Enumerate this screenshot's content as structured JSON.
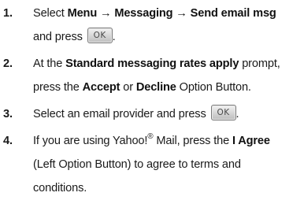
{
  "steps": [
    {
      "number": "1.",
      "line1_a": "Select ",
      "menu_path": "Menu → Messaging → Send email msg",
      "line2_a": "and press ",
      "ok_key": "OK",
      "line2_b": "."
    },
    {
      "number": "2.",
      "line1_a": "At the ",
      "prompt_name": "Standard messaging rates apply",
      "line1_b": " prompt,",
      "line2_a": "press the ",
      "accept": "Accept",
      "or": " or ",
      "decline": "Decline",
      "line2_b": " Option Button."
    },
    {
      "number": "3.",
      "line1_a": "Select an email provider and press ",
      "ok_key": "OK",
      "line1_b": "."
    },
    {
      "number": "4.",
      "line1_a": "If you are using Yahoo!",
      "registered": "®",
      "line1_b": " Mail, press the ",
      "i_agree": "I Agree",
      "line2": "(Left Option Button) to agree to terms and",
      "line3": "conditions."
    }
  ]
}
